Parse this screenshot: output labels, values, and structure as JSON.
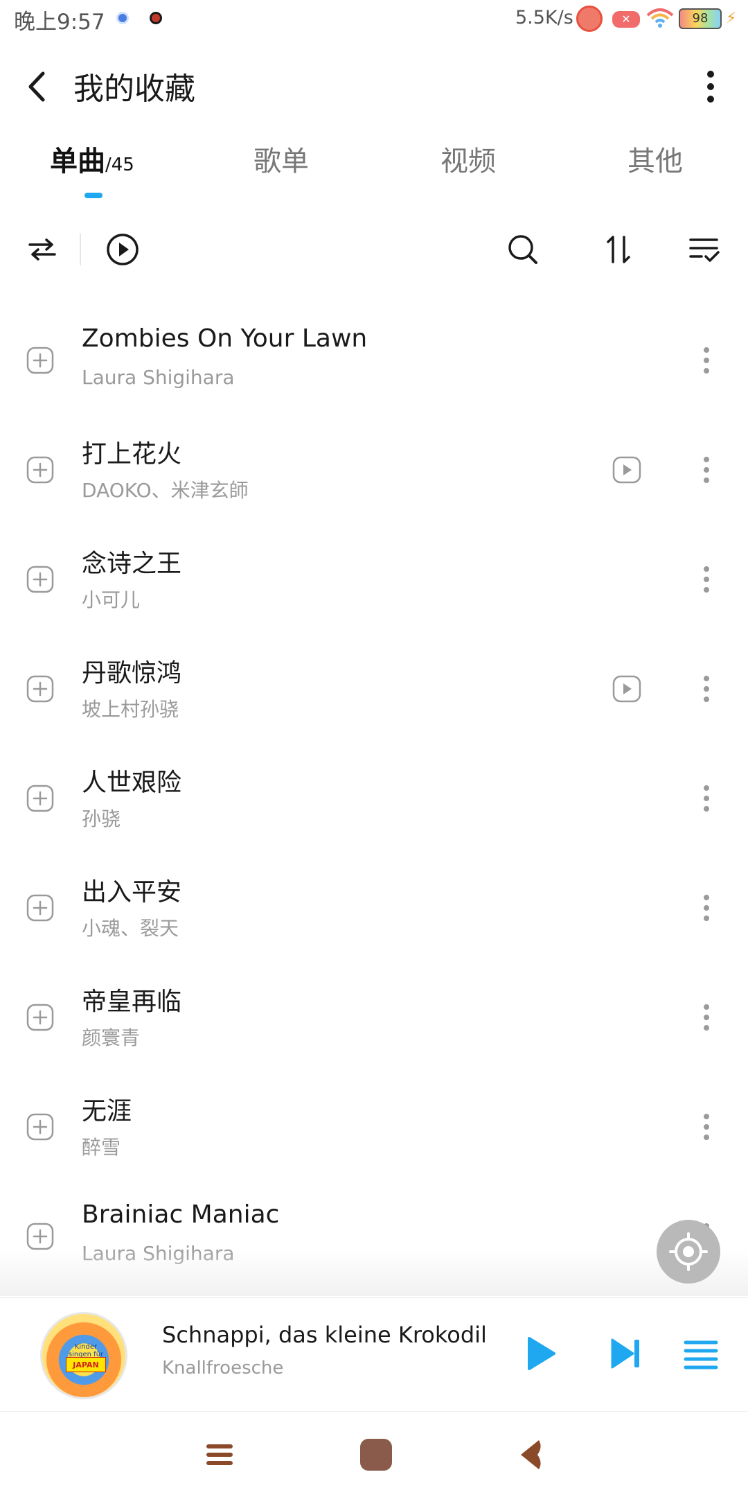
{
  "status_bar": {
    "time": "晚上9:57",
    "net_speed": "5.5K/s",
    "battery": "98"
  },
  "header": {
    "title": "我的收藏"
  },
  "tabs": [
    {
      "label": "单曲",
      "count": "/45"
    },
    {
      "label": "歌单"
    },
    {
      "label": "视频"
    },
    {
      "label": "其他"
    }
  ],
  "songs": [
    {
      "title": "Zombies On Your Lawn",
      "artist": "Laura Shigihara",
      "mv": false
    },
    {
      "title": "打上花火",
      "artist": "DAOKO、米津玄師",
      "mv": true
    },
    {
      "title": "念诗之王",
      "artist": "小可儿",
      "mv": false
    },
    {
      "title": "丹歌惊鸿",
      "artist": "坡上村孙骁",
      "mv": true
    },
    {
      "title": "人世艰险",
      "artist": "孙骁",
      "mv": false
    },
    {
      "title": "出入平安",
      "artist": "小魂、裂天",
      "mv": false
    },
    {
      "title": "帝皇再临",
      "artist": "颜寰青",
      "mv": false
    },
    {
      "title": "无涯",
      "artist": "醉雪",
      "mv": false
    },
    {
      "title": "Brainiac Maniac",
      "artist": "Laura Shigihara",
      "mv": false
    }
  ],
  "now_playing": {
    "title": "Schnappi, das kleine Krokodil",
    "artist": "Knallfroesche",
    "album_label": "JAPAN",
    "album_sub": "Kinder singen für"
  },
  "colors": {
    "accent": "#1fa8f0",
    "nav_icons": "#8a4a2a"
  },
  "icons": {
    "toolbar": [
      "shuffle-icon",
      "play-circle-icon",
      "search-icon",
      "sort-icon",
      "multi-select-icon"
    ],
    "row": [
      "add-icon",
      "mv-icon",
      "more-vertical-icon"
    ],
    "player": [
      "play-icon",
      "next-icon",
      "queue-icon"
    ],
    "nav": [
      "menu-icon",
      "home-icon",
      "back-icon"
    ]
  }
}
